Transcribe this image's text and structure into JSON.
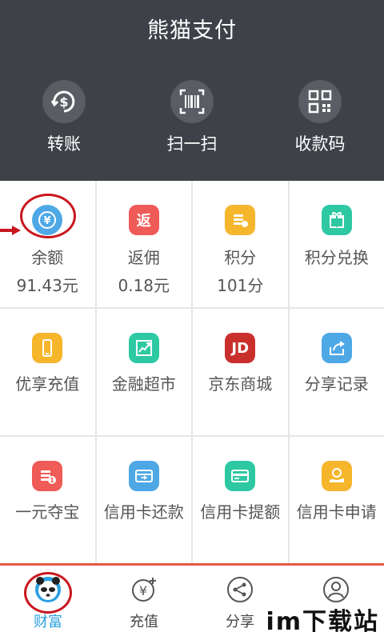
{
  "header": {
    "title": "熊猫支付",
    "actions": [
      {
        "label": "转账",
        "icon": "dollar-transfer-icon"
      },
      {
        "label": "扫一扫",
        "icon": "barcode-scan-icon"
      },
      {
        "label": "收款码",
        "icon": "qrcode-icon"
      }
    ]
  },
  "grid": {
    "balance": {
      "label": "余额",
      "value": "91.43元",
      "icon_text": "¥"
    },
    "rebate": {
      "label": "返佣",
      "value": "0.18元",
      "icon_text": "返"
    },
    "points": {
      "label": "积分",
      "value": "101分"
    },
    "points_exchange": {
      "label": "积分兑换"
    },
    "premium_topup": {
      "label": "优享充值"
    },
    "finance_market": {
      "label": "金融超市"
    },
    "jd_mall": {
      "label": "京东商城",
      "icon_text": "JD"
    },
    "share_records": {
      "label": "分享记录"
    },
    "one_yuan": {
      "label": "一元夺宝"
    },
    "cc_repay": {
      "label": "信用卡还款"
    },
    "cc_limit": {
      "label": "信用卡提额"
    },
    "cc_apply": {
      "label": "信用卡申请"
    }
  },
  "tabbar": {
    "wealth": "财富",
    "recharge": "充值",
    "share": "分享",
    "mine": ""
  },
  "watermark": "im下载站",
  "colors": {
    "header_bg": "#3e4148",
    "accent_red": "#c9161e",
    "active_tab": "#2aa0e0",
    "icon_blue": "#4ea8e6",
    "icon_red": "#ef5b57",
    "icon_yellow": "#f5b62c",
    "icon_teal": "#2ec9a3",
    "icon_darkred": "#c9302c"
  }
}
